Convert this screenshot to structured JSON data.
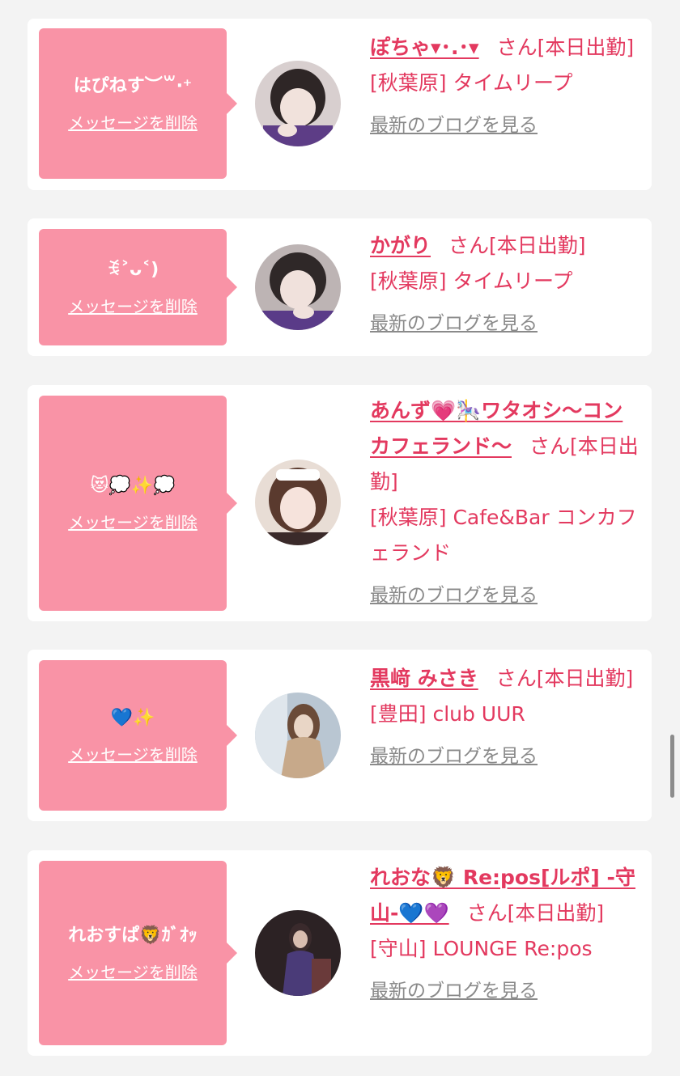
{
  "cards": [
    {
      "message": "はぴねす︶꒳​​​​​​​​ ​​​​​​​​​​​​​​​​ ​​​​​​꒳",
      "delete_label": "メッセージを削除",
      "name": "ぽちゃ▾･.･▾",
      "suffix": "さん[本日出勤]",
      "shop": "[秋葉原] タイムリープ",
      "blog_label": "最新のブログを見る",
      "avatar_colors": [
        "#3a3030",
        "#efdfd8",
        "#5d3d86"
      ]
    },
    {
      "message": "ꉂ˃ᴗ˂)",
      "delete_label": "メッセージを削除",
      "name": "かがり",
      "suffix": "さん[本日出勤]",
      "shop": "[秋葉原] タイムリープ",
      "blog_label": "最新のブログを見る",
      "avatar_colors": [
        "#3b3232",
        "#f0e1dc",
        "#5a3b88"
      ]
    },
    {
      "message": "😻💭✨💭",
      "delete_label": "メッセージを削除",
      "name": "あんず💗🎠ワタオシ〜コンカフェランド〜",
      "suffix": "さん[本日出勤]",
      "shop": "[秋葉原] Cafe&Bar コンカフェランド",
      "blog_label": "最新のブログを見る",
      "avatar_colors": [
        "#5a3a2e",
        "#f6e3dc",
        "#e8ddd5"
      ]
    },
    {
      "message": "💙✨",
      "delete_label": "メッセージを削除",
      "name": "黒﨑 みさき",
      "suffix": "さん[本日出勤]",
      "shop": "[豊田] club UUR",
      "blog_label": "最新のブログを見る",
      "avatar_colors": [
        "#b9c6d2",
        "#e9d6c6",
        "#c7a98a"
      ]
    },
    {
      "message": "れおすぱ🦁ｶﾞｵｯ",
      "delete_label": "メッセージを削除",
      "name": "れおな🦁 Re:pos[ルポ] -守山-💙💜",
      "suffix": "さん[本日出勤]",
      "shop": "[守山] LOUNGE Re:pos",
      "blog_label": "最新のブログを見る",
      "avatar_colors": [
        "#3a2a2c",
        "#d9bdb0",
        "#4a3b78"
      ]
    }
  ]
}
